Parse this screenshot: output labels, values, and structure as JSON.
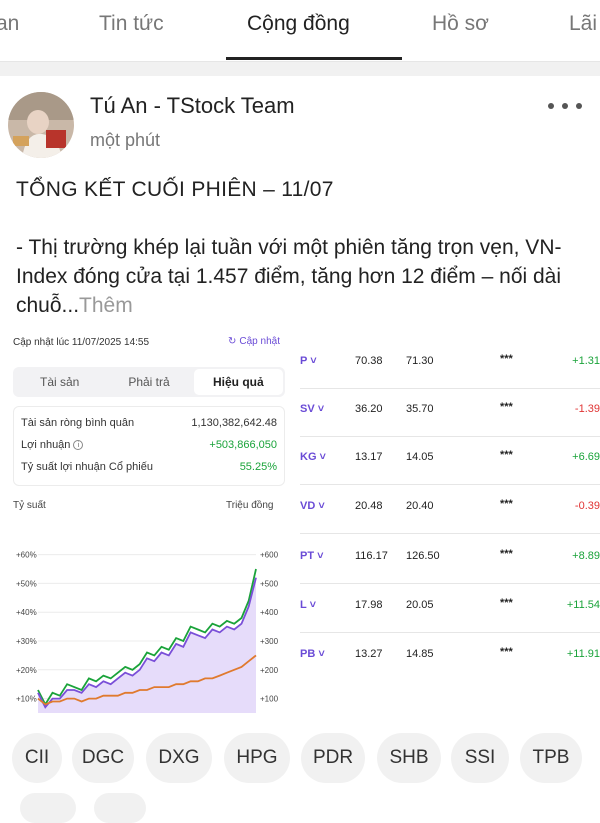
{
  "tabs": [
    {
      "label": "an"
    },
    {
      "label": "Tin tức"
    },
    {
      "label": "Cộng đồng"
    },
    {
      "label": "Hồ sơ"
    },
    {
      "label": "Lãi"
    }
  ],
  "post": {
    "author": "Tú An - TStock Team",
    "time": "một phút",
    "headline": "TỔNG KẾT CUỐI PHIÊN – 11/07",
    "body": "- Thị trường khép lại tuần với một phiên tăng trọn vẹn, VN-Index đóng cửa tại 1.457 điểm, tăng hơn 12 điểm – nối dài chuỗ...",
    "more": "Thêm"
  },
  "shot": {
    "updated": "Cập nhật lúc 11/07/2025 14:55",
    "refresh": "Cập nhật",
    "segments": [
      "Tài sản",
      "Phải trả",
      "Hiệu quả"
    ],
    "stats": [
      {
        "label": "Tài sản ròng bình quân",
        "value": "1,130,382,642.48"
      },
      {
        "label": "Lợi nhuận",
        "value": "+503,866,050"
      },
      {
        "label": "Tỷ suất lợi nhuận Cổ phiếu",
        "value": "55.25%"
      }
    ],
    "axis_left": "Tỷ suất",
    "axis_right": "Triệu đồng",
    "quotes": [
      {
        "sym": "P ˅",
        "p1": "70.38",
        "p2": "71.30",
        "stars": "***",
        "chg": "+1.31"
      },
      {
        "sym": "SV ˅",
        "p1": "36.20",
        "p2": "35.70",
        "stars": "***",
        "chg": "-1.39"
      },
      {
        "sym": "KG ˅",
        "p1": "13.17",
        "p2": "14.05",
        "stars": "***",
        "chg": "+6.69"
      },
      {
        "sym": "VD ˅",
        "p1": "20.48",
        "p2": "20.40",
        "stars": "***",
        "chg": "-0.39"
      },
      {
        "sym": "PT ˅",
        "p1": "116.17",
        "p2": "126.50",
        "stars": "***",
        "chg": "+8.89"
      },
      {
        "sym": "L ˅",
        "p1": "17.98",
        "p2": "20.05",
        "stars": "***",
        "chg": "+11.54"
      },
      {
        "sym": "PB ˅",
        "p1": "13.27",
        "p2": "14.85",
        "stars": "***",
        "chg": "+11.91"
      }
    ]
  },
  "chips": [
    "CII",
    "DGC",
    "DXG",
    "HPG",
    "PDR",
    "SHB",
    "SSI",
    "TPB"
  ],
  "colors": {
    "accent": "#6a4bd6",
    "green": "#1aa33a",
    "orange": "#e07a2e",
    "red": "#e03434"
  },
  "chart_data": {
    "type": "line",
    "title": "",
    "xlabel": "",
    "ylabel": "Tỷ suất",
    "y2label": "Triệu đồng",
    "yticks": [
      "+10%",
      "+20%",
      "+30%",
      "+40%",
      "+50%",
      "+60%"
    ],
    "y2ticks": [
      "+100",
      "+200",
      "+300",
      "+400",
      "+500",
      "+600"
    ],
    "ylim": [
      5,
      63
    ],
    "series": [
      {
        "color": "#1aa33a",
        "values": [
          13,
          8,
          12,
          11,
          15,
          14,
          13,
          17,
          16,
          18,
          17,
          19,
          21,
          20,
          22,
          26,
          25,
          28,
          27,
          31,
          30,
          35,
          34,
          33,
          36,
          35,
          37,
          36,
          38,
          44,
          55
        ]
      },
      {
        "color": "#7a4fd8",
        "values": [
          12,
          7,
          10,
          10,
          13,
          13,
          12,
          15,
          14,
          16,
          15,
          17,
          19,
          18,
          20,
          24,
          23,
          26,
          25,
          29,
          28,
          33,
          32,
          31,
          34,
          33,
          35,
          34,
          36,
          42,
          52
        ]
      },
      {
        "color": "#e07a2e",
        "values": [
          10,
          8,
          9,
          9,
          10,
          10,
          9,
          10,
          10,
          11,
          11,
          11,
          12,
          12,
          13,
          13,
          14,
          14,
          14,
          15,
          15,
          16,
          16,
          17,
          17,
          18,
          19,
          20,
          21,
          23,
          25
        ]
      }
    ]
  }
}
